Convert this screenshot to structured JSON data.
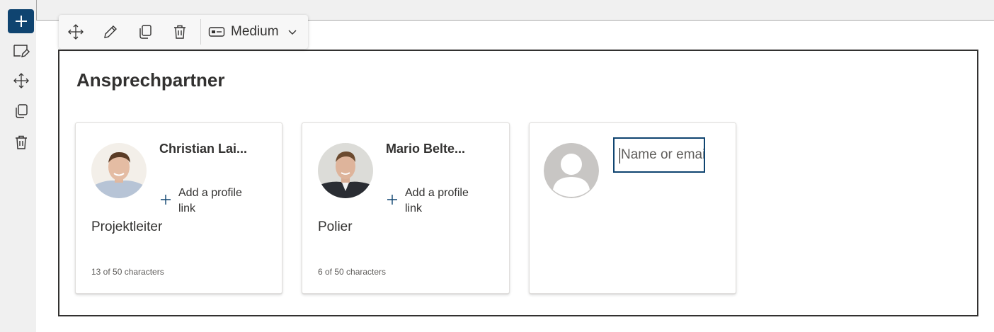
{
  "toolbar": {
    "size_label": "Medium"
  },
  "section": {
    "title": "Ansprechpartner"
  },
  "cards": [
    {
      "name": "Christian Lai...",
      "add_link_label": "Add a profile link",
      "job_title": "Projektleiter",
      "char_count": "13 of 50 characters"
    },
    {
      "name": "Mario Belte...",
      "add_link_label": "Add a profile link",
      "job_title": "Polier",
      "char_count": "6 of 50 characters"
    }
  ],
  "new_card": {
    "placeholder": "Name or email"
  },
  "colors": {
    "accent": "#0f4470",
    "text": "#323130",
    "muted": "#605e5c",
    "frame": "#323130",
    "placeholder_avatar": "#c8c6c4"
  },
  "icons": {
    "side": [
      "plus-icon",
      "edit-section-icon",
      "move-icon",
      "duplicate-icon",
      "delete-icon"
    ],
    "float": [
      "move-icon",
      "pencil-icon",
      "duplicate-icon",
      "delete-icon",
      "size-icon",
      "chevron-down-icon"
    ]
  }
}
